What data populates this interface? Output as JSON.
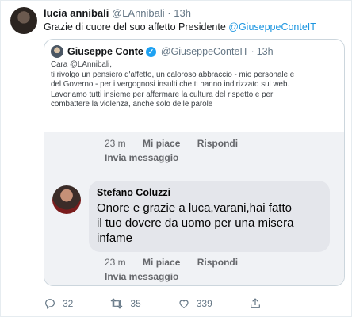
{
  "tweet": {
    "author_name": "lucia annibali",
    "author_handle": "@LAnnibali",
    "separator": "·",
    "time": "13h",
    "text_prefix": "Grazie di cuore del suo affetto Presidente ",
    "text_mention": "@GiuseppeConteIT"
  },
  "quote": {
    "author_name": "Giuseppe Conte",
    "author_handle": "@GiuseppeConteIT",
    "separator": "·",
    "time": "13h",
    "letter_lines": [
      "Cara @LAnnibali,",
      "ti rivolgo un pensiero d'affetto, un caloroso abbraccio - mio personale e",
      "del Governo - per i vergognosi insulti che ti hanno indirizzato sul web.",
      "Lavoriamo tutti insieme per affermare la cultura del rispetto e per",
      "combattere la violenza, anche solo delle parole"
    ],
    "facebook": {
      "row1": {
        "time": "23 m",
        "like": "Mi piace",
        "reply": "Rispondi"
      },
      "send1": "Invia messaggio",
      "comment": {
        "author": "Stefano Coluzzi",
        "lines": [
          "Onore e grazie a luca,varani,hai fatto",
          "il tuo dovere da uomo per una misera",
          "infame"
        ]
      },
      "row2": {
        "time": "23 m",
        "like": "Mi piace",
        "reply": "Rispondi"
      },
      "send2": "Invia messaggio"
    }
  },
  "actions": {
    "reply_count": "32",
    "retweet_count": "35",
    "like_count": "339"
  },
  "icons": [
    "reply-icon",
    "retweet-icon",
    "like-icon",
    "share-icon",
    "verified-icon"
  ],
  "colors": {
    "link": "#1b95e0",
    "verified": "#1da1f2",
    "muted": "#657786",
    "fb_panel": "#f0f2f5",
    "fb_bubble": "#e4e6eb"
  }
}
